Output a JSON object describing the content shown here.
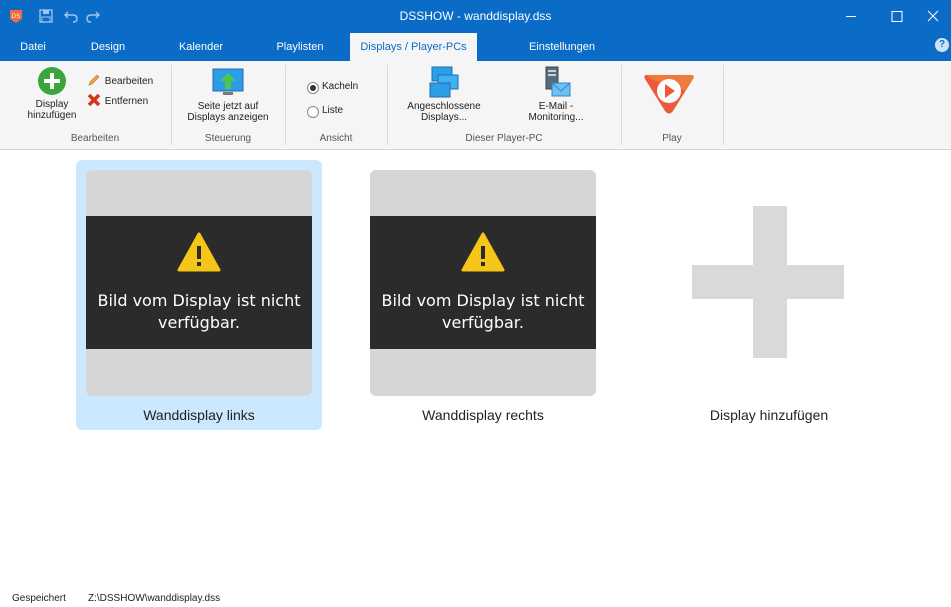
{
  "window": {
    "title": "DSSHOW - wanddisplay.dss",
    "app_icon_text": "DS"
  },
  "tabs": [
    {
      "label": "Datei"
    },
    {
      "label": "Design"
    },
    {
      "label": "Kalender"
    },
    {
      "label": "Playlisten"
    },
    {
      "label": "Displays / Player-PCs"
    },
    {
      "label": "Einstellungen"
    }
  ],
  "active_tab": "Displays / Player-PCs",
  "help_label": "?",
  "ribbon": {
    "groups": [
      {
        "label": "Bearbeiten"
      },
      {
        "label": "Steuerung"
      },
      {
        "label": "Ansicht"
      },
      {
        "label": "Dieser Player-PC"
      },
      {
        "label": "Play"
      }
    ],
    "add_display": {
      "line1": "Display",
      "line2": "hinzufügen"
    },
    "edit": "Bearbeiten",
    "remove": "Entfernen",
    "show_page": {
      "line1": "Seite jetzt auf",
      "line2": "Displays anzeigen"
    },
    "view_tiles": "Kacheln",
    "view_list": "Liste",
    "view_selected": "Kacheln",
    "connected": {
      "line1": "Angeschlossene",
      "line2": "Displays..."
    },
    "email": {
      "line1": "E-Mail -",
      "line2": "Monitoring..."
    }
  },
  "displays": [
    {
      "name": "Wanddisplay links",
      "selected": true,
      "message_line1": "Bild vom Display ist nicht",
      "message_line2": "verfügbar."
    },
    {
      "name": "Wanddisplay rechts",
      "selected": false,
      "message_line1": "Bild vom Display ist nicht",
      "message_line2": "verfügbar."
    }
  ],
  "add_tile_label": "Display hinzufügen",
  "status": {
    "state": "Gespeichert",
    "path": "Z:\\DSSHOW\\wanddisplay.dss"
  },
  "colors": {
    "accent": "#0a6cc7",
    "selection": "#cce8ff",
    "tile_bg": "#d6d6d6",
    "tile_band": "#2b2b2b",
    "warning": "#f5c518"
  }
}
